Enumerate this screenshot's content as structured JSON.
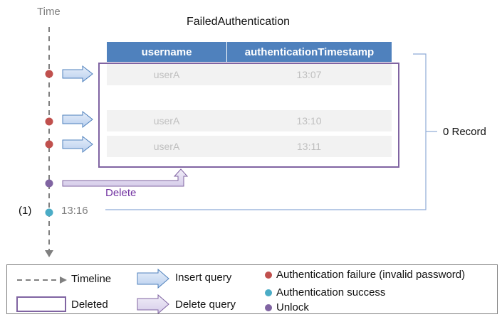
{
  "time_axis": {
    "label": "Time"
  },
  "table": {
    "title": "FailedAuthentication",
    "columns": [
      "username",
      "authenticationTimestamp"
    ],
    "rows": [
      {
        "username": "userA",
        "timestamp": "13:07"
      },
      {
        "username": "userA",
        "timestamp": "13:10"
      },
      {
        "username": "userA",
        "timestamp": "13:11"
      }
    ]
  },
  "annotations": {
    "record_count": "0 Record",
    "delete_label": "Delete",
    "marker": "(1)",
    "marker_time": "13:16"
  },
  "events": [
    {
      "type": "failure",
      "color": "#c0504d"
    },
    {
      "type": "failure",
      "color": "#c0504d"
    },
    {
      "type": "failure",
      "color": "#c0504d"
    },
    {
      "type": "unlock",
      "color": "#8064a2"
    },
    {
      "type": "success",
      "color": "#4bacc6"
    }
  ],
  "legend": {
    "timeline": "Timeline",
    "insert_query": "Insert query",
    "auth_failure": "Authentication failure (invalid password)",
    "deleted": "Deleted",
    "delete_query": "Delete query",
    "auth_success": "Authentication success",
    "unlock": "Unlock"
  },
  "colors": {
    "header": "#4f81bd",
    "row_fill": "#f2f2f2",
    "failure": "#c0504d",
    "success": "#4bacc6",
    "unlock": "#8064a2",
    "insert_arrow": "#c6d9f1",
    "delete_arrow": "#e4dff0"
  }
}
